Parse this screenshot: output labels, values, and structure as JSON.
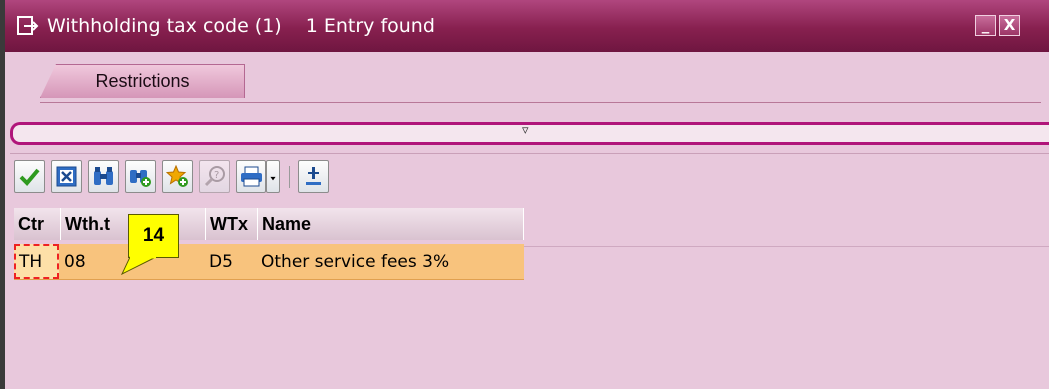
{
  "window": {
    "title": "Withholding tax code (1)",
    "status": "1 Entry found",
    "minimize_label": "_",
    "close_label": "X"
  },
  "tabs": [
    {
      "label": "Restrictions"
    }
  ],
  "toolbar": {
    "icons": [
      "check-icon",
      "cancel-icon",
      "find-icon",
      "find-next-icon",
      "favorite-add-icon",
      "help-icon",
      "print-icon",
      "dropdown-icon",
      "settings-icon"
    ]
  },
  "grid": {
    "columns": [
      "Ctr",
      "Wth.t",
      "WTx",
      "Name"
    ],
    "rows": [
      {
        "ctr": "TH",
        "wtht": "08",
        "wtx": "D5",
        "name": "Other service fees 3%"
      }
    ]
  },
  "tooltip": {
    "text": "14"
  },
  "colors": {
    "titlebar": "#87204f",
    "background": "#e8c8dc",
    "selected_row": "#f8c37d",
    "tooltip": "#ffff00"
  }
}
